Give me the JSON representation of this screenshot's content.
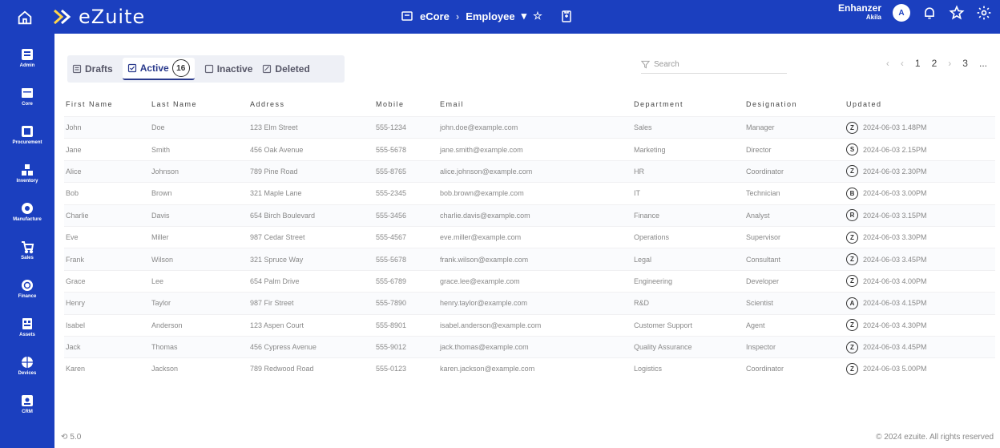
{
  "topbar": {
    "brand": "eZuite",
    "breadcrumb": [
      "eCore",
      "Employee"
    ],
    "user_name": "Enhanzer",
    "user_sub": "Akila",
    "avatar_initial": "A",
    "icons": [
      "home-icon",
      "brand-logo-icon",
      "core-icon",
      "chevron-down-icon",
      "star-icon",
      "clipboard-icon",
      "bell-icon",
      "star-icon",
      "gear-icon"
    ]
  },
  "sidebar": {
    "items": [
      {
        "label": "Admin",
        "icon": "admin-icon"
      },
      {
        "label": "Core",
        "icon": "core-icon"
      },
      {
        "label": "Procurement",
        "icon": "procurement-icon"
      },
      {
        "label": "Inventory",
        "icon": "inventory-icon"
      },
      {
        "label": "Manufacture",
        "icon": "manufacture-icon"
      },
      {
        "label": "Sales",
        "icon": "cart-icon"
      },
      {
        "label": "Finance",
        "icon": "finance-icon"
      },
      {
        "label": "Assets",
        "icon": "assets-icon"
      },
      {
        "label": "Devices",
        "icon": "devices-icon"
      },
      {
        "label": "CRM",
        "icon": "crm-icon"
      }
    ]
  },
  "tabs": {
    "drafts": "Drafts",
    "active": "Active",
    "active_count": "16",
    "inactive": "Inactive",
    "deleted": "Deleted"
  },
  "search": {
    "placeholder": "Search"
  },
  "pager": {
    "items": [
      "‹",
      "‹",
      "1",
      "2",
      "›",
      "3",
      "..."
    ]
  },
  "table": {
    "columns": [
      "First Name",
      "Last Name",
      "Address",
      "Mobile",
      "Email",
      "Department",
      "Designation",
      "Updated"
    ],
    "rows": [
      {
        "first": "John",
        "last": "Doe",
        "address": "123 Elm Street",
        "mobile": "555-1234",
        "email": "john.doe@example.com",
        "dept": "Sales",
        "designation": "Manager",
        "badge": "Z",
        "updated": "2024-06-03 1.48PM"
      },
      {
        "first": "Jane",
        "last": "Smith",
        "address": "456 Oak Avenue",
        "mobile": "555-5678",
        "email": "jane.smith@example.com",
        "dept": "Marketing",
        "designation": "Director",
        "badge": "S",
        "updated": "2024-06-03 2.15PM"
      },
      {
        "first": "Alice",
        "last": "Johnson",
        "address": "789 Pine Road",
        "mobile": "555-8765",
        "email": "alice.johnson@example.com",
        "dept": "HR",
        "designation": "Coordinator",
        "badge": "Z",
        "updated": "2024-06-03 2.30PM"
      },
      {
        "first": "Bob",
        "last": "Brown",
        "address": "321 Maple Lane",
        "mobile": "555-2345",
        "email": "bob.brown@example.com",
        "dept": "IT",
        "designation": "Technician",
        "badge": "B",
        "updated": "2024-06-03 3.00PM"
      },
      {
        "first": "Charlie",
        "last": "Davis",
        "address": "654 Birch Boulevard",
        "mobile": "555-3456",
        "email": "charlie.davis@example.com",
        "dept": "Finance",
        "designation": "Analyst",
        "badge": "R",
        "updated": "2024-06-03 3.15PM"
      },
      {
        "first": "Eve",
        "last": "Miller",
        "address": "987 Cedar Street",
        "mobile": "555-4567",
        "email": "eve.miller@example.com",
        "dept": "Operations",
        "designation": "Supervisor",
        "badge": "Z",
        "updated": "2024-06-03 3.30PM"
      },
      {
        "first": "Frank",
        "last": "Wilson",
        "address": "321 Spruce Way",
        "mobile": "555-5678",
        "email": "frank.wilson@example.com",
        "dept": "Legal",
        "designation": "Consultant",
        "badge": "Z",
        "updated": "2024-06-03 3.45PM"
      },
      {
        "first": "Grace",
        "last": "Lee",
        "address": "654 Palm Drive",
        "mobile": "555-6789",
        "email": "grace.lee@example.com",
        "dept": "Engineering",
        "designation": "Developer",
        "badge": "Z",
        "updated": "2024-06-03 4.00PM"
      },
      {
        "first": "Henry",
        "last": "Taylor",
        "address": "987 Fir Street",
        "mobile": "555-7890",
        "email": "henry.taylor@example.com",
        "dept": "R&D",
        "designation": "Scientist",
        "badge": "A",
        "updated": "2024-06-03 4.15PM"
      },
      {
        "first": "Isabel",
        "last": "Anderson",
        "address": "123 Aspen Court",
        "mobile": "555-8901",
        "email": "isabel.anderson@example.com",
        "dept": "Customer Support",
        "designation": "Agent",
        "badge": "Z",
        "updated": "2024-06-03 4.30PM"
      },
      {
        "first": "Jack",
        "last": "Thomas",
        "address": "456 Cypress Avenue",
        "mobile": "555-9012",
        "email": "jack.thomas@example.com",
        "dept": "Quality Assurance",
        "designation": "Inspector",
        "badge": "Z",
        "updated": "2024-06-03 4.45PM"
      },
      {
        "first": "Karen",
        "last": "Jackson",
        "address": "789 Redwood Road",
        "mobile": "555-0123",
        "email": "karen.jackson@example.com",
        "dept": "Logistics",
        "designation": "Coordinator",
        "badge": "Z",
        "updated": "2024-06-03 5.00PM"
      }
    ]
  },
  "footer": {
    "version": "5.0",
    "copyright": "© 2024 ezuite. All rights reserved"
  },
  "colors": {
    "primary": "#1b3fbf",
    "background": "#ffffff"
  }
}
